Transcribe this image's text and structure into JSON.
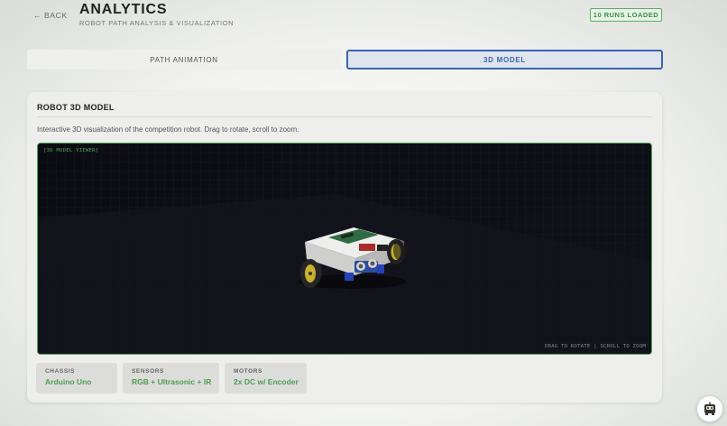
{
  "header": {
    "back_label": "← BACK",
    "title": "ANALYTICS",
    "subtitle": "ROBOT PATH ANALYSIS & VISUALIZATION",
    "runs_badge": "10 RUNS LOADED"
  },
  "tabs": [
    {
      "label": "PATH ANIMATION",
      "active": false
    },
    {
      "label": "3D MODEL",
      "active": true
    }
  ],
  "card": {
    "title": "ROBOT 3D MODEL",
    "description": "Interactive 3D visualization of the competition robot. Drag to rotate, scroll to zoom.",
    "viewer_tag": "[3D MODEL VIEWER]",
    "viewer_hint": "DRAG TO ROTATE | SCROLL TO ZOOM"
  },
  "specs": [
    {
      "label": "CHASSIS",
      "value": "Arduino Uno"
    },
    {
      "label": "SENSORS",
      "value": "RGB + Ultrasonic + IR"
    },
    {
      "label": "MOTORS",
      "value": "2x DC w/ Encoder"
    }
  ],
  "colors": {
    "accent_blue": "#3b63b6",
    "accent_green": "#4e9f53",
    "viewer_background": "#0a0b10"
  },
  "icons": {
    "fab": "robot-icon"
  }
}
